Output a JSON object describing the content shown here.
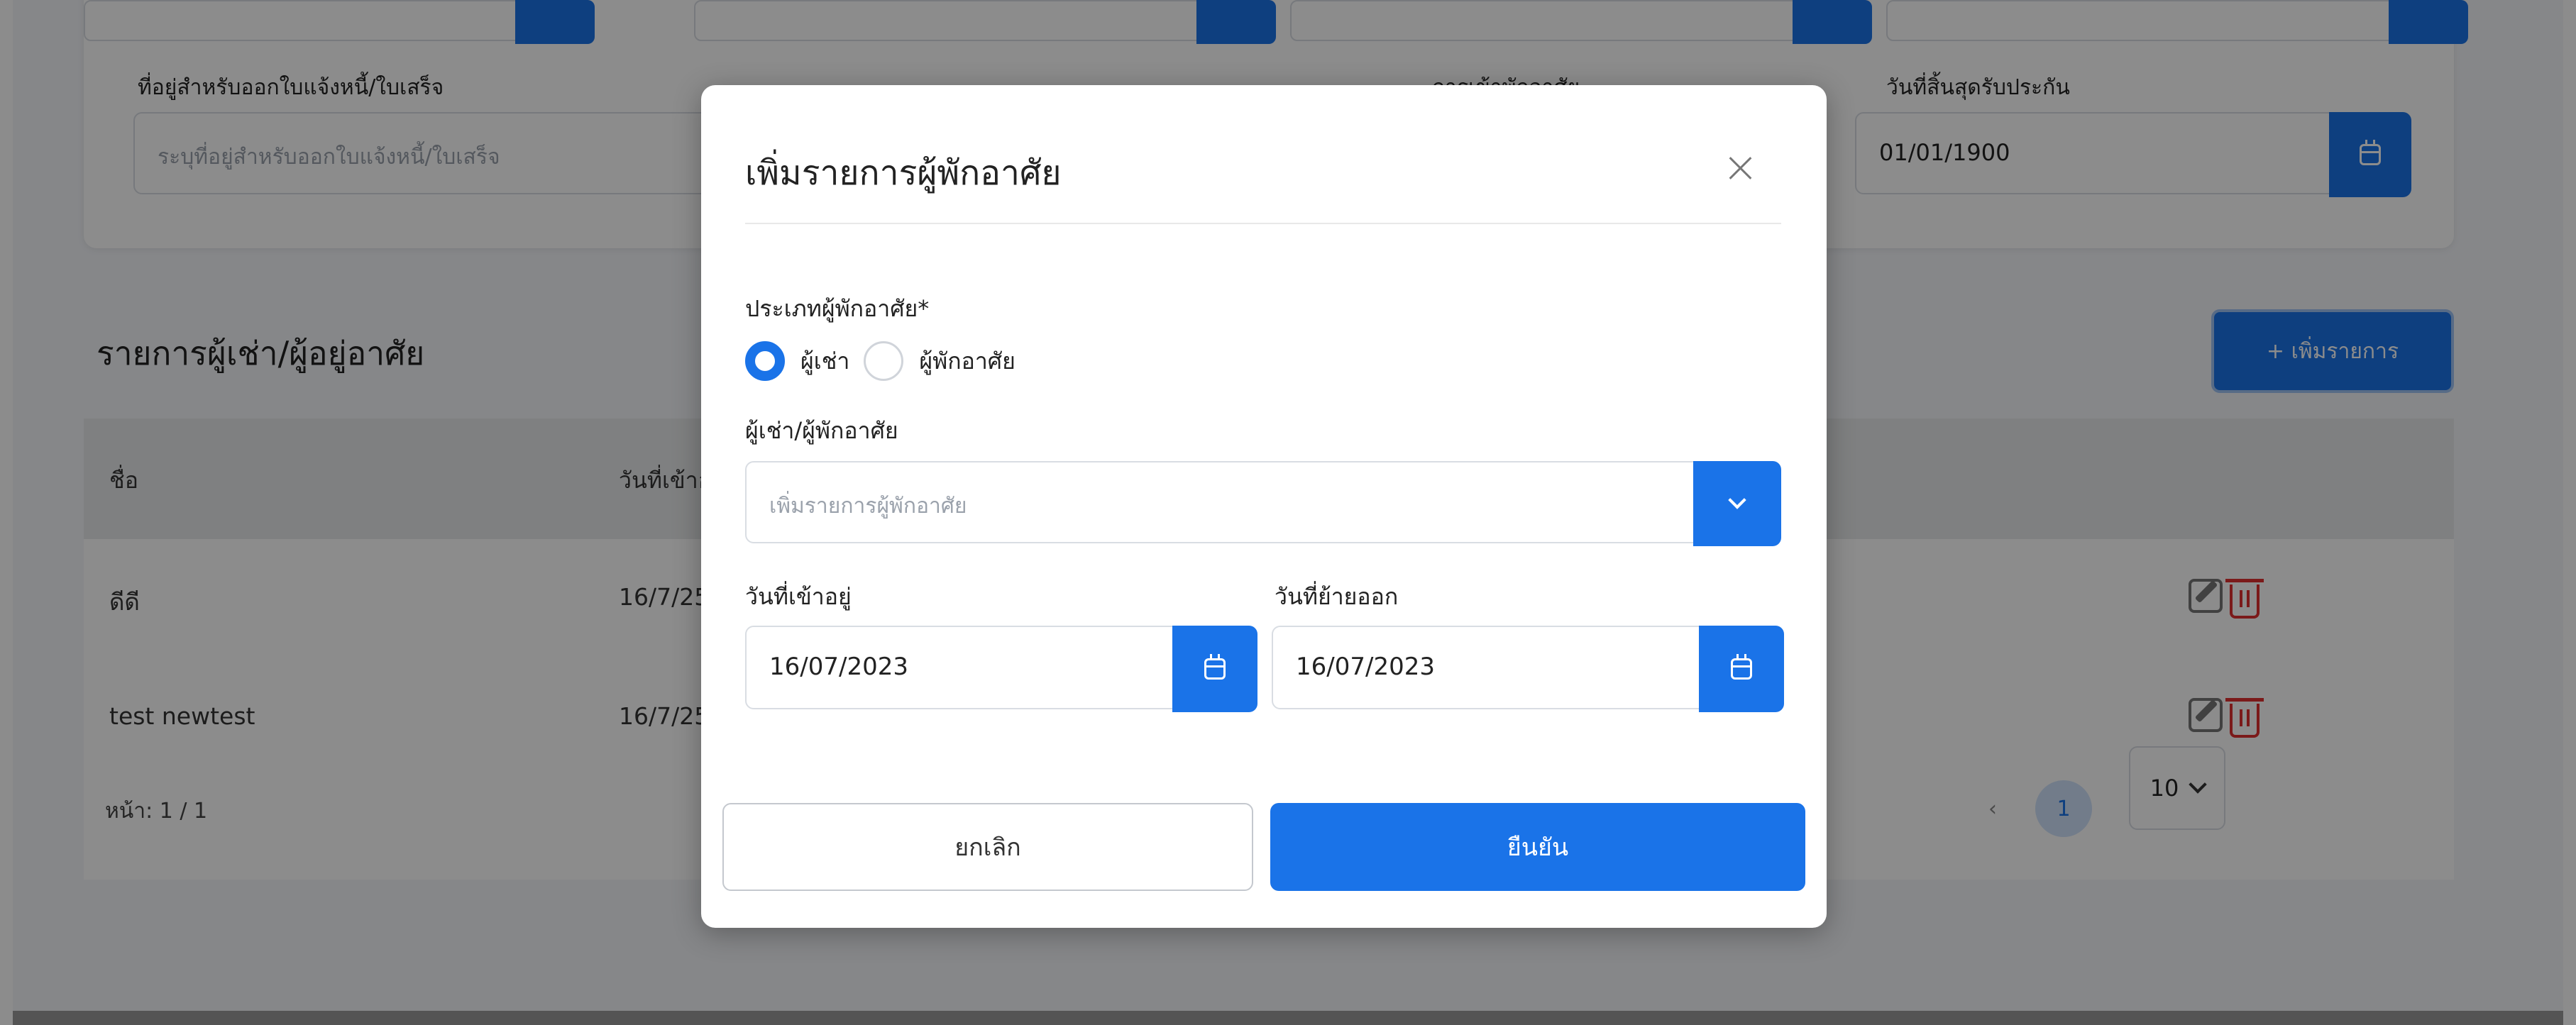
{
  "background": {
    "address_label": "ที่อยู่สำหรับออกใบแจ้งหนี้/ใบเสร็จ",
    "address_placeholder": "ระบุที่อยู่สำหรับออกใบแจ้งหนี้/ใบเสร็จ",
    "residence_label": "การเข้าพักอาศัย",
    "warranty_end_label": "วันที่สิ้นสุดรับประกัน",
    "warranty_end_value": "01/01/1900",
    "section_title": "รายการผู้เช่า/ผู้อยู่อาศัย",
    "add_button": "+ เพิ่มรายการ",
    "table": {
      "headers": [
        "ชื่อ",
        "วันที่เข้าอ"
      ],
      "rows": [
        {
          "name": "ดีดี",
          "date": "16/7/25"
        },
        {
          "name": "test newtest",
          "date": "16/7/25"
        }
      ]
    },
    "pagination": {
      "page_label": "หน้า: 1 / 1",
      "prev": "‹",
      "current": "1",
      "next": "›",
      "last": "»",
      "per_page": "10"
    }
  },
  "modal": {
    "title": "เพิ่มรายการผู้พักอาศัย",
    "type_label": "ประเภทผู้พักอาศัย*",
    "radio_options": [
      "ผู้เช่า",
      "ผู้พักอาศัย"
    ],
    "selected_option": "ผู้เช่า",
    "occupant_label": "ผู้เช่า/ผู้พักอาศัย",
    "occupant_placeholder": "เพิ่มรายการผู้พักอาศัย",
    "move_in_label": "วันที่เข้าอยู่",
    "move_in_value": "16/07/2023",
    "move_out_label": "วันที่ย้ายออก",
    "move_out_value": "16/07/2023",
    "cancel_label": "ยกเลิก",
    "confirm_label": "ยืนยัน"
  },
  "colors": {
    "primary": "#1a73e8",
    "danger": "#e03131",
    "overlay": "rgba(0,0,0,0.45)"
  }
}
